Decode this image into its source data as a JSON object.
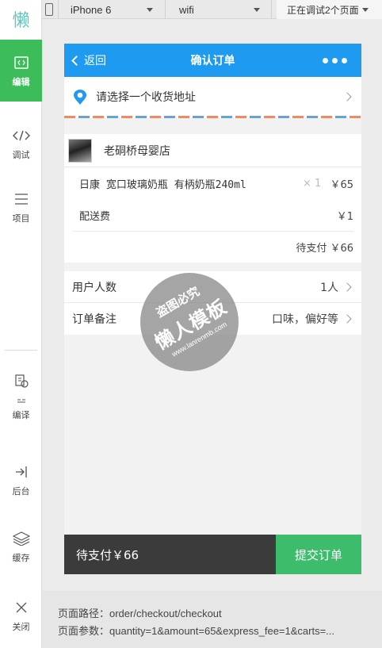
{
  "app": {
    "logo_char": "懒"
  },
  "sidebar": {
    "items": [
      {
        "label": "编辑",
        "icon": "code-icon",
        "active": true
      },
      {
        "label": "调试",
        "icon": "code-icon"
      },
      {
        "label": "项目",
        "icon": "menu-icon"
      },
      {
        "label": "编译",
        "icon": "compile-icon"
      },
      {
        "label": "后台",
        "icon": "background-icon"
      },
      {
        "label": "缓存",
        "icon": "layers-icon"
      },
      {
        "label": "关闭",
        "icon": "close-icon"
      }
    ]
  },
  "toolbar": {
    "device": "iPhone 6",
    "network": "wifi",
    "debug_status": "正在调试2个页面"
  },
  "page": {
    "nav": {
      "back_label": "返回",
      "title": "确认订单"
    },
    "address": {
      "placeholder": "请选择一个收货地址"
    },
    "shop": {
      "name": "老硐桥母婴店"
    },
    "goods": [
      {
        "name": "日康 宽口玻璃奶瓶 有柄奶瓶240ml",
        "qty": "× 1",
        "price": "￥65"
      }
    ],
    "shipping": {
      "label": "配送费",
      "value": "￥1"
    },
    "subtotal": {
      "text": "待支付 ￥66"
    },
    "info_rows": [
      {
        "label": "用户人数",
        "value": "1人"
      },
      {
        "label": "订单备注",
        "value": "口味，偏好等"
      }
    ],
    "bottom": {
      "pay_text": "待支付￥66",
      "submit_label": "提交订单"
    }
  },
  "watermark": {
    "line1": "盗图必究",
    "line2": "懒人模板",
    "line3": "www.lanrenmb.com"
  },
  "footer": {
    "path": "页面路径：order/checkout/checkout",
    "params": "页面参数：quantity=1&amount=65&express_fee=1&carts=..."
  },
  "colors": {
    "accent_green": "#3dbd5a",
    "nav_blue": "#1e9af0",
    "submit_green": "#3dbd6c",
    "logo_teal": "#5cc6c0"
  }
}
